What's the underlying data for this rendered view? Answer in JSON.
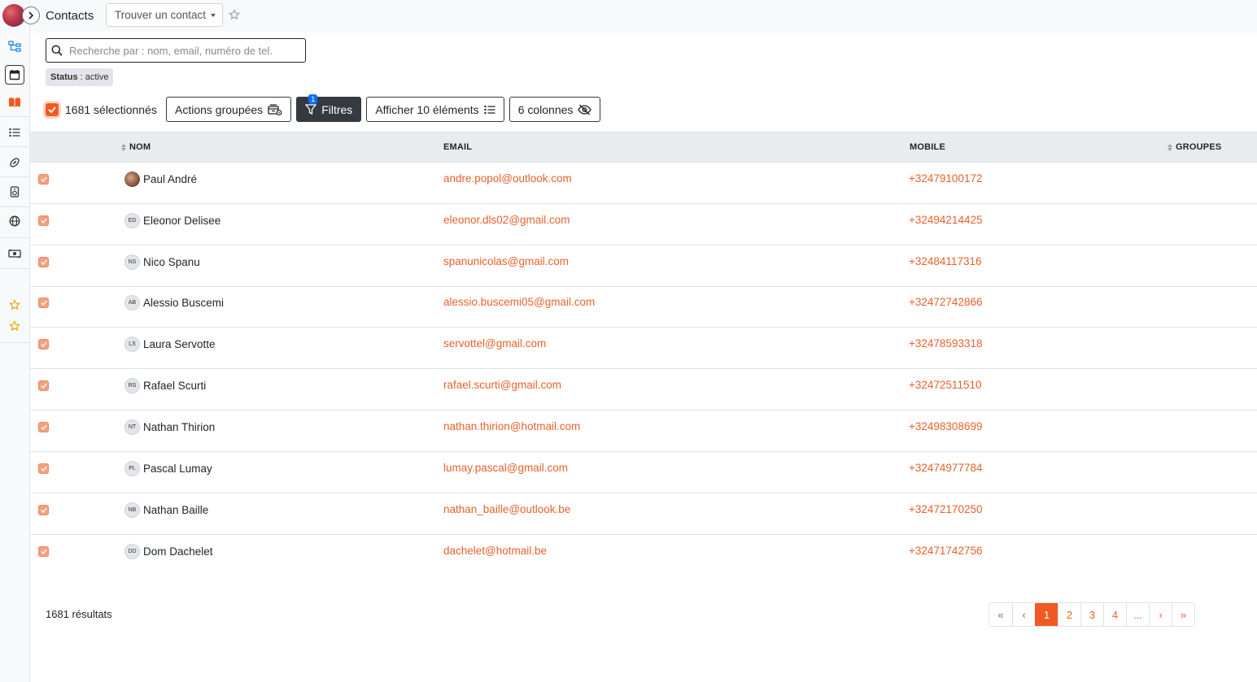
{
  "header": {
    "title": "Contacts",
    "find_contact_label": "Trouver un contact"
  },
  "search": {
    "placeholder": "Recherche par : nom, email, numéro de tel.",
    "value": ""
  },
  "status_filter": {
    "key": "Status",
    "value": ": active"
  },
  "toolbar": {
    "selected_label": "1681 sélectionnés",
    "bulk_actions_label": "Actions groupées",
    "filters_label": "Filtres",
    "filters_count": "1",
    "show_items_label": "Afficher 10 éléments",
    "columns_label": "6 colonnes"
  },
  "table": {
    "columns": {
      "name": "NOM",
      "email": "EMAIL",
      "mobile": "MOBILE",
      "groups": "GROUPES"
    },
    "rows": [
      {
        "initials": "",
        "name": "Paul André",
        "email": "andre.popol@outlook.com",
        "mobile": "+32479100172"
      },
      {
        "initials": "ED",
        "name": "Eleonor Delisee",
        "email": "eleonor.dls02@gmail.com",
        "mobile": "+32494214425"
      },
      {
        "initials": "NS",
        "name": "Nico Spanu",
        "email": "spanunicolas@gmail.com",
        "mobile": "+32484117316"
      },
      {
        "initials": "AB",
        "name": "Alessio Buscemi",
        "email": "alessio.buscemi05@gmail.com",
        "mobile": "+32472742866"
      },
      {
        "initials": "LS",
        "name": "Laura Servotte",
        "email": "servottel@gmail.com",
        "mobile": "+32478593318"
      },
      {
        "initials": "RS",
        "name": "Rafael Scurti",
        "email": "rafael.scurti@gmail.com",
        "mobile": "+32472511510"
      },
      {
        "initials": "NT",
        "name": "Nathan Thirion",
        "email": "nathan.thirion@hotmail.com",
        "mobile": "+32498308699"
      },
      {
        "initials": "PL",
        "name": "Pascal Lumay",
        "email": "lumay.pascal@gmail.com",
        "mobile": "+32474977784"
      },
      {
        "initials": "NB",
        "name": "Nathan Baille",
        "email": "nathan_baille@outlook.be",
        "mobile": "+32472170250"
      },
      {
        "initials": "DD",
        "name": "Dom Dachelet",
        "email": "dachelet@hotmail.be",
        "mobile": "+32471742756"
      }
    ]
  },
  "footer": {
    "results_label": "1681 résultats",
    "pagination": [
      "«",
      "‹",
      "1",
      "2",
      "3",
      "4",
      "...",
      "›",
      "»"
    ],
    "active_page": "1"
  },
  "colors": {
    "accent": "#f05a22",
    "link": "#e8612c",
    "dark_button": "#343a40",
    "badge": "#0d6efd"
  }
}
